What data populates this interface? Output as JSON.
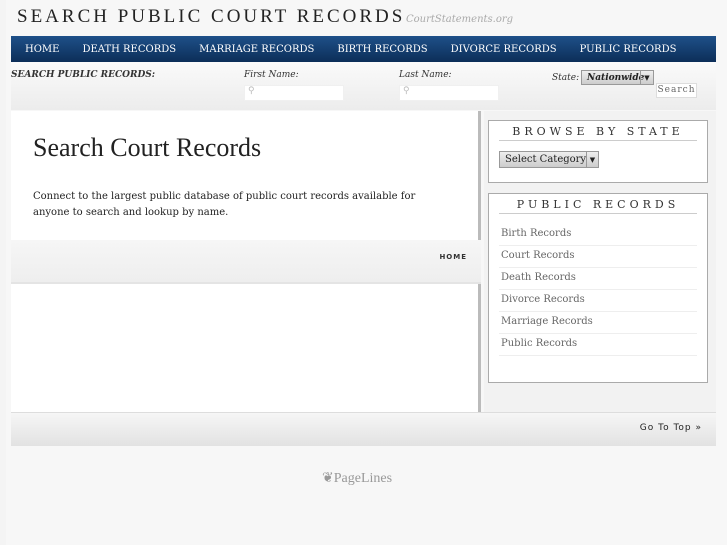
{
  "header": {
    "title": "SEARCH PUBLIC COURT RECORDS",
    "tagline": "CourtStatements.org"
  },
  "nav": [
    "HOME",
    "DEATH RECORDS",
    "MARRIAGE RECORDS",
    "BIRTH RECORDS",
    "DIVORCE RECORDS",
    "PUBLIC RECORDS"
  ],
  "search": {
    "heading": "SEARCH PUBLIC RECORDS:",
    "first_name_label": "First Name:",
    "last_name_label": "Last Name:",
    "state_label": "State:",
    "state_value": "Nationwide",
    "search_label": "Search"
  },
  "main": {
    "title": "Search Court Records",
    "intro": "Connect to the largest public database of public court records available for anyone to search and lookup by name.",
    "breadcrumb": "HOME"
  },
  "sidebar": {
    "browse_title": "BROWSE BY STATE",
    "category_value": "Select Category",
    "records_title": "PUBLIC RECORDS",
    "records": [
      "Birth Records",
      "Court Records",
      "Death Records",
      "Divorce Records",
      "Marriage Records",
      "Public Records"
    ]
  },
  "footer": {
    "go_top": "Go To Top »",
    "logo": "PageLines"
  }
}
